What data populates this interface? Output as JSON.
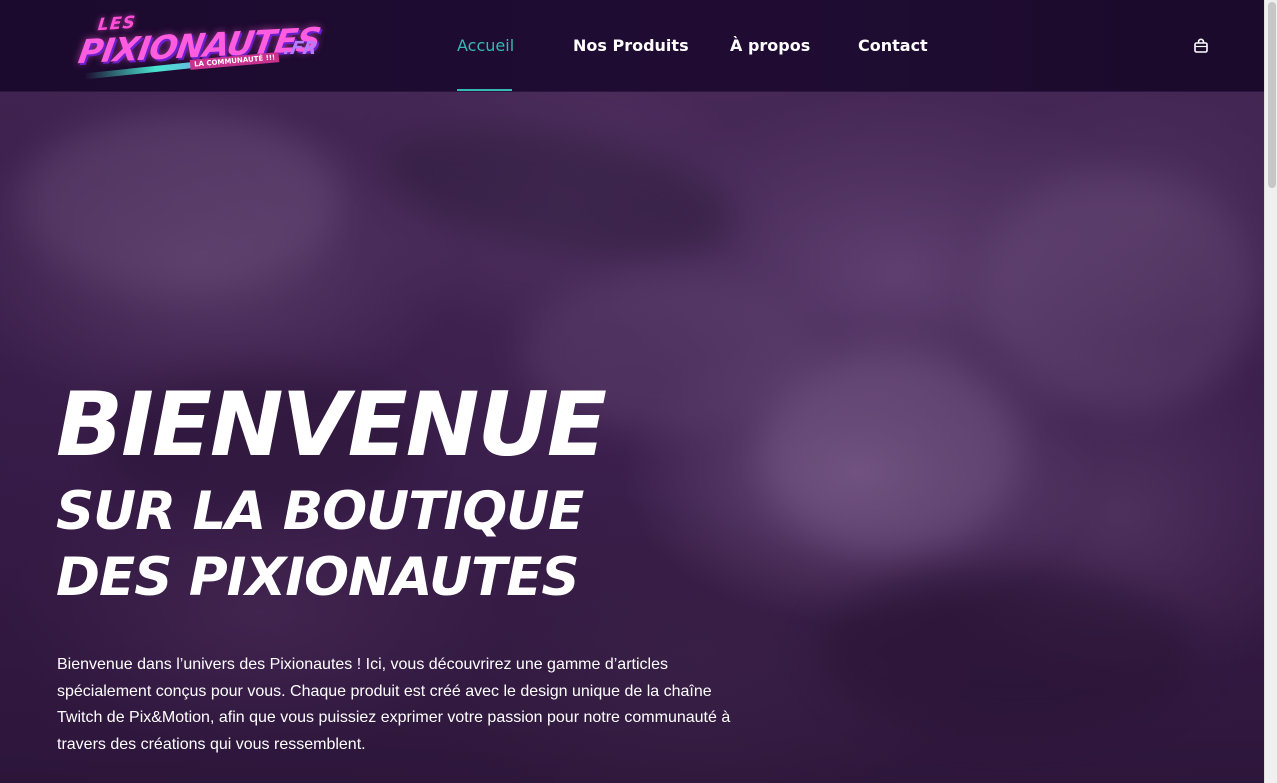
{
  "brand": {
    "logo_les": "LES",
    "logo_main": "PIXIONAUTES",
    "logo_tld": ".FR",
    "logo_tagline": "LA COMMUNAUTÉ !!!"
  },
  "nav": {
    "items": [
      {
        "label": "Accueil",
        "active": true
      },
      {
        "label": "Nos Produits",
        "active": false
      },
      {
        "label": "À propos",
        "active": false
      },
      {
        "label": "Contact",
        "active": false
      }
    ],
    "cart_icon": "shopping-bag-icon"
  },
  "hero": {
    "title_big": "BIENVENUE",
    "title_line1": "SUR LA BOUTIQUE",
    "title_line2": "DES PIXIONAUTES",
    "paragraph": "Bienvenue dans l’univers des Pixionautes ! Ici, vous découvrirez une gamme d’articles spécialement conçus pour vous. Chaque produit est créé avec le design unique de la chaîne Twitch de Pix&Motion, afin que vous puissiez exprimer votre passion pour notre communauté à travers des créations qui vous ressemblent."
  },
  "colors": {
    "accent": "#37b8b5",
    "header_bg": "#1e0b30",
    "hero_tint": "#4a2a5a",
    "logo_pink": "#ff5ce0"
  }
}
